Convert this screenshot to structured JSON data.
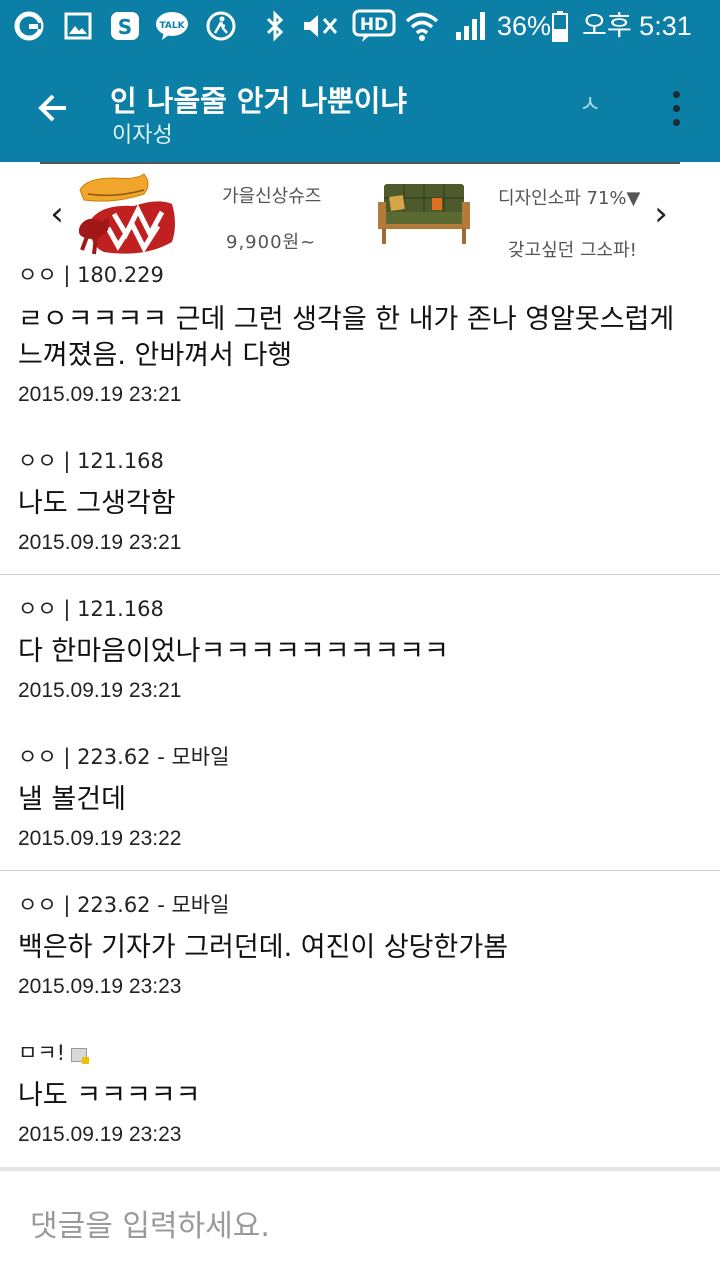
{
  "status_bar": {
    "battery": "36%",
    "time": "오후 5:31",
    "hd_label": "HD",
    "icons": [
      "sync-icon",
      "gallery-icon",
      "skype-icon",
      "kakaotalk-icon",
      "walking-icon",
      "bluetooth-icon",
      "mute-icon",
      "hd-voice-icon",
      "wifi-icon",
      "signal-icon",
      "battery-icon"
    ],
    "talk_label": "TALK"
  },
  "app_bar": {
    "title": "인 나올줄 안거 나뿐이냐",
    "subtitle": "이자성",
    "search_glyph": "ㅅ",
    "background": "#0c7fa6"
  },
  "ad": {
    "left": {
      "name": "가을신상슈즈",
      "price": "9,900원~"
    },
    "right": {
      "name": "디자인소파 71%▼",
      "caption": "갖고싶던 그소파!"
    }
  },
  "comments": [
    {
      "author": "ㅇㅇ",
      "meta": "ㅇㅇ | 180.229",
      "body": "ㄹㅇㅋㅋㅋㅋ 근데 그런 생각을 한 내가 존나 영알못스럽게 느껴졌음. 안바껴서 다행",
      "date": "2015.09.19 23:21"
    },
    {
      "author": "ㅇㅇ",
      "meta": "ㅇㅇ | 121.168",
      "body": "나도 그생각함",
      "date": "2015.09.19 23:21"
    },
    {
      "author": "ㅇㅇ",
      "meta": "ㅇㅇ | 121.168",
      "body": "다 한마음이었나ㅋㅋㅋㅋㅋㅋㅋㅋㅋㅋ",
      "date": "2015.09.19 23:21"
    },
    {
      "author": "ㅇㅇ",
      "meta": "ㅇㅇ | 223.62 - 모바일",
      "body": "낼 볼건데",
      "date": "2015.09.19 23:22"
    },
    {
      "author": "ㅇㅇ",
      "meta": "ㅇㅇ | 223.62 - 모바일",
      "body": "백은하 기자가 그러던데. 여진이 상당한가봄",
      "date": "2015.09.19 23:23"
    },
    {
      "author": "ㅁㅋ!",
      "meta": "ㅁㅋ!",
      "body": "나도 ㅋㅋㅋㅋㅋ",
      "date": "2015.09.19 23:23"
    }
  ],
  "input": {
    "placeholder": "댓글을 입력하세요."
  }
}
